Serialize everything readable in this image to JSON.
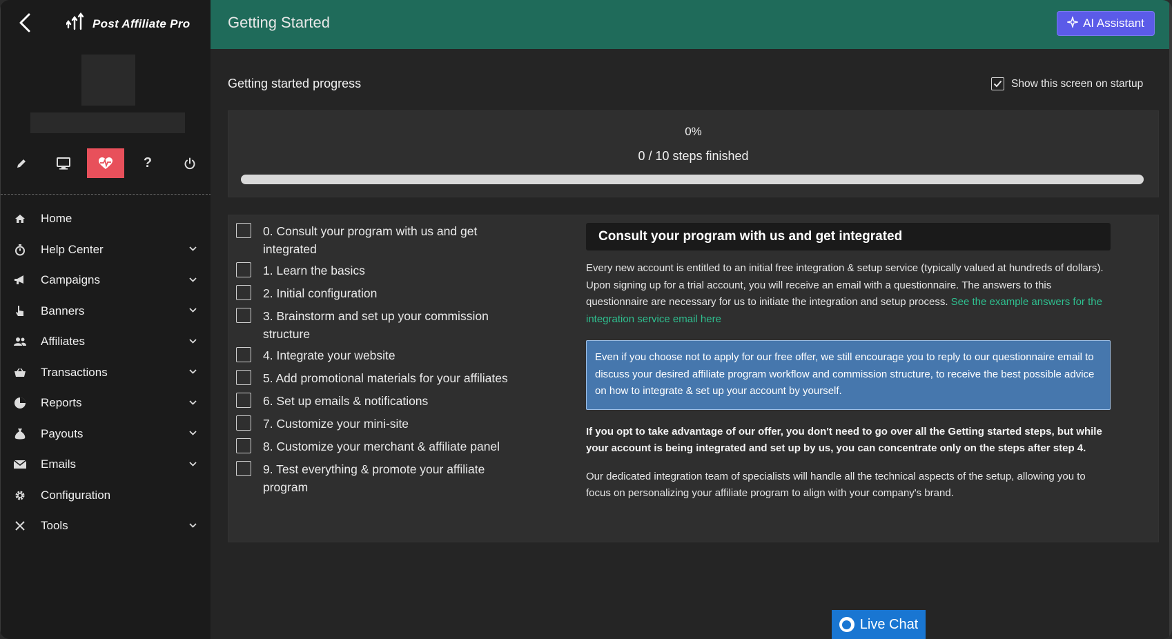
{
  "app": {
    "name": "Post Affiliate Pro"
  },
  "header": {
    "title": "Getting Started",
    "ai_button_label": "AI Assistant"
  },
  "toolbar": {
    "icons": [
      "pencil-icon",
      "monitor-icon",
      "heartbeat-icon",
      "question-icon",
      "power-icon"
    ],
    "active_icon": "heartbeat-icon",
    "active_color": "#e8505b"
  },
  "nav": {
    "items": [
      {
        "label": "Home",
        "icon": "home-icon",
        "expandable": false
      },
      {
        "label": "Help Center",
        "icon": "stopwatch-icon",
        "expandable": true
      },
      {
        "label": "Campaigns",
        "icon": "megaphone-icon",
        "expandable": true
      },
      {
        "label": "Banners",
        "icon": "pointer-hand-icon",
        "expandable": true
      },
      {
        "label": "Affiliates",
        "icon": "users-icon",
        "expandable": true
      },
      {
        "label": "Transactions",
        "icon": "basket-icon",
        "expandable": true
      },
      {
        "label": "Reports",
        "icon": "pie-chart-icon",
        "expandable": true
      },
      {
        "label": "Payouts",
        "icon": "money-bag-icon",
        "expandable": true
      },
      {
        "label": "Emails",
        "icon": "envelope-icon",
        "expandable": true
      },
      {
        "label": "Configuration",
        "icon": "gear-icon",
        "expandable": false
      },
      {
        "label": "Tools",
        "icon": "tools-icon",
        "expandable": true
      }
    ]
  },
  "progress": {
    "title": "Getting started progress",
    "show_on_startup_label": "Show this screen on startup",
    "show_on_startup": true,
    "percent_label": "0%",
    "percent": 0,
    "steps_finished_label": "0 / 10 steps finished"
  },
  "steps": [
    {
      "label": "0. Consult your program with us and get integrated",
      "done": false
    },
    {
      "label": "1. Learn the basics",
      "done": false
    },
    {
      "label": "2. Initial configuration",
      "done": false
    },
    {
      "label": "3. Brainstorm and set up your commission structure",
      "done": false
    },
    {
      "label": "4. Integrate your website",
      "done": false
    },
    {
      "label": "5. Add promotional materials for your affiliates",
      "done": false
    },
    {
      "label": "6. Set up emails & notifications",
      "done": false
    },
    {
      "label": "7. Customize your mini-site",
      "done": false
    },
    {
      "label": "8. Customize your merchant & affiliate panel",
      "done": false
    },
    {
      "label": "9. Test everything & promote your affiliate program",
      "done": false
    }
  ],
  "detail": {
    "heading": "Consult your program with us and get integrated",
    "paragraph1": "Every new account is entitled to an initial free integration & setup service (typically valued at hundreds of dollars). Upon signing up for a trial account, you will receive an email with a questionnaire. The answers to this questionnaire are necessary for us to initiate the integration and setup process.",
    "link_text": "See the example answers for the integration service email here",
    "info_box": "Even if you choose not to apply for our free offer, we still encourage you to reply to our questionnaire email to discuss your desired affiliate program workflow and commission structure, to receive the best possible advice on how to integrate & set up your account by yourself.",
    "bold_paragraph": "If you opt to take advantage of our offer, you don't need to go over all the Getting started steps, but while your account is being integrated and set up by us, you can concentrate only on the steps after step 4.",
    "paragraph3": "Our dedicated integration team of specialists will handle all the technical aspects of the setup, allowing you to focus on personalizing your affiliate program to align with your company's brand."
  },
  "live_chat": {
    "label": "Live Chat"
  },
  "colors": {
    "header_bg": "#1f6b5a",
    "ai_button": "#5b5be8",
    "link": "#2fbf8f",
    "info_box": "#4677ad",
    "live_chat": "#1976d2"
  }
}
